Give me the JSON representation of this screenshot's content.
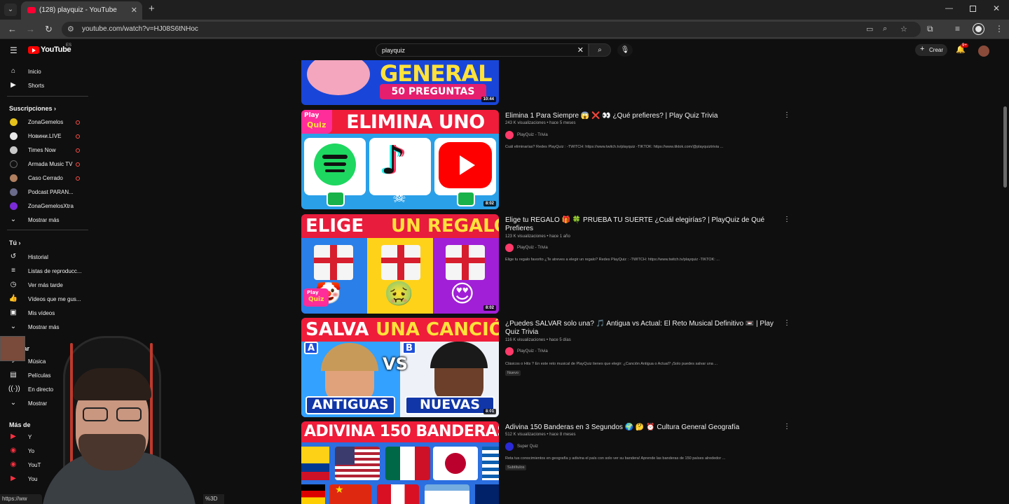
{
  "browser": {
    "tab_title": "(128) playquiz - YouTube",
    "url": "youtube.com/watch?v=HJ08S6tNHoc",
    "status_url": "https://ww",
    "status_right": "%3D"
  },
  "header": {
    "logo_text": "YouTube",
    "country": "ES",
    "search_value": "playquiz",
    "create_label": "Crear",
    "notif_count": "9+"
  },
  "sidebar": {
    "main": [
      {
        "label": "Inicio",
        "icon": "home-icon"
      },
      {
        "label": "Shorts",
        "icon": "shorts-icon"
      }
    ],
    "subs_heading": "Suscripciones",
    "subs": [
      {
        "label": "ZonaGemelos",
        "color": "#e6c21a",
        "live": true
      },
      {
        "label": "Новини.LIVE",
        "color": "#e8e8e8",
        "live": true
      },
      {
        "label": "Times Now",
        "color": "#c8c8c8",
        "live": true
      },
      {
        "label": "Armada Music TV",
        "color": "#111111",
        "live": true
      },
      {
        "label": "Caso Cerrado",
        "color": "#b08060",
        "live": true
      },
      {
        "label": "Podcast PARAN...",
        "color": "#6a6a8a",
        "live": false
      },
      {
        "label": "ZonaGemelosXtra",
        "color": "#7a2ad6",
        "live": false
      }
    ],
    "show_more": "Mostrar más",
    "you_heading": "Tú",
    "you": [
      {
        "label": "Historial",
        "icon": "history-icon"
      },
      {
        "label": "Listas de reproducc...",
        "icon": "playlists-icon"
      },
      {
        "label": "Ver más tarde",
        "icon": "watch-later-icon"
      },
      {
        "label": "Vídeos que me gus...",
        "icon": "like-icon"
      },
      {
        "label": "Mis vídeos",
        "icon": "my-videos-icon"
      },
      {
        "label": "Mostrar más",
        "icon": "chevron-down-icon"
      }
    ],
    "explore_heading": "rar",
    "explore": [
      {
        "label": "Música",
        "icon": "music-icon"
      },
      {
        "label": "Películas",
        "icon": "movies-icon"
      },
      {
        "label": "En directo",
        "icon": "live-icon"
      },
      {
        "label": "Mostrar",
        "icon": "chevron-down-icon"
      }
    ],
    "more_heading": "Más de",
    "more": [
      {
        "label": "Y"
      },
      {
        "label": "Yo"
      },
      {
        "label": "YouT"
      },
      {
        "label": "You"
      }
    ]
  },
  "results": [
    {
      "kind": "top-partial",
      "thumb_text": [
        "GENERAL",
        "50 PREGUNTAS"
      ],
      "duration": "10:44"
    },
    {
      "title": "Elimina 1 Para Siempre 😱 ❌ 👀 ¿Qué prefieres? | Play Quiz Trivia",
      "meta": "243 K visualizaciones • hace 5 meses",
      "channel": "PlayQuiz - Trivia",
      "desc": "Cuál eliminarías? Redes PlayQuiz : -TWITCH: https://www.twitch.tv/playquiz -TIKTOK: https://www.tiktok.com/@playquiztrivia ...",
      "badge": "",
      "duration": "8:02",
      "thumb_text": [
        "ELIMINA UNO"
      ],
      "thumb_logo": [
        "Play",
        "Quiz"
      ]
    },
    {
      "title": "Elige tu REGALO 🎁 🍀 PRUEBA TU SUERTE ¿Cuál elegirías? | PlayQuiz de Qué Prefieres",
      "meta": "123 K visualizaciones • hace 1 año",
      "channel": "PlayQuiz - Trivia",
      "desc": "Elige tu regalo favorito ¿Te atreves a elegir un regalo? Redes PlayQuiz : -TWITCH: https://www.twitch.tv/playquiz -TIKTOK: ...",
      "badge": "",
      "duration": "8:02",
      "thumb_text": [
        "ELIGE",
        "UN REGALO"
      ],
      "thumb_logo": [
        "Play",
        "Quiz"
      ]
    },
    {
      "title": "¿Puedes SALVAR solo una? 🎵 Antigua vs Actual: El Reto Musical Definitivo 📼 | Play Quiz Trivia",
      "meta": "116 K visualizaciones • hace 5 días",
      "channel": "PlayQuiz - Trivia",
      "desc": "Clásicos o Hits ? En este reto musical de PlayQuiz tienes que elegir: ¿Canción Antigua o Actual? ¡Solo puedes salvar una ...",
      "badge": "Nuevo",
      "duration": "8:01",
      "thumb_text": [
        "SALVA",
        "UNA CANCIÓN",
        "ANTIGUAS",
        "NUEVAS",
        "A",
        "B",
        "VS"
      ]
    },
    {
      "title": "Adivina 150 Banderas en 3 Segundos 🌍 🤔 ⏰ Cultura General Geografía",
      "meta": "512 K visualizaciones • hace 8 meses",
      "channel": "Super Quiz",
      "desc": "Reta tus conocimientos en geografía y adivina el país con solo ver su bandera! Aprende las banderas de 150 países alrededor ...",
      "badge": "Subtítulos",
      "duration": "",
      "thumb_text": [
        "ADIVINA 150 BANDERAS"
      ]
    }
  ],
  "colors": {
    "bg": "#0f0f0f",
    "brand_red": "#ff0000",
    "text": "#f1f1f1",
    "meta": "#aaaaaa"
  }
}
